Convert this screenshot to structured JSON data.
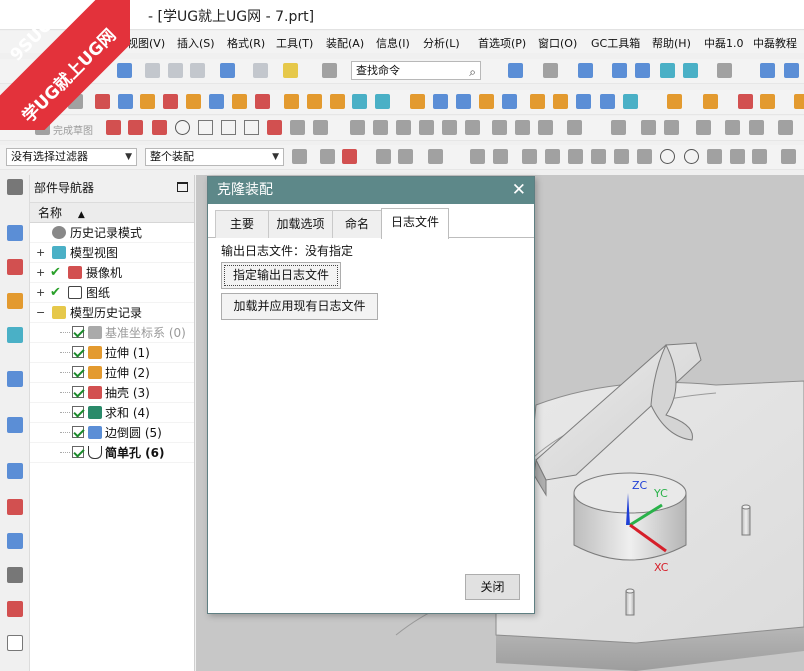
{
  "title_bar": {
    "title": "- [学UG就上UG网 - 7.prt]"
  },
  "watermark": {
    "line1": "9SUG",
    "line2": "学UG就上UG网"
  },
  "menu_bar": {
    "items": [
      "视图(V)",
      "插入(S)",
      "格式(R)",
      "工具(T)",
      "装配(A)",
      "信息(I)",
      "分析(L)",
      "首选项(P)",
      "窗口(O)",
      "GC工具箱",
      "帮助(H)",
      "中磊1.0",
      "中磊教程"
    ]
  },
  "toolbar": {
    "find_command_placeholder": "查找命令",
    "finish_sketch_label": "完成草图",
    "selection_filter": "没有选择过滤器",
    "assembly_scope": "整个装配"
  },
  "navigator": {
    "title": "部件导航器",
    "column_name": "名称",
    "sort_indicator": "▲",
    "items": [
      {
        "label": "历史记录模式",
        "checked": false,
        "disabled": false,
        "bold": false,
        "icon": "clock-icon"
      },
      {
        "label": "模型视图",
        "checked": false,
        "disabled": false,
        "bold": false,
        "icon": "model-views-icon"
      },
      {
        "label": "摄像机",
        "checked": true,
        "disabled": false,
        "bold": false,
        "icon": "camera-icon"
      },
      {
        "label": "图纸",
        "checked": true,
        "disabled": false,
        "bold": false,
        "icon": "drawing-sheet-icon"
      },
      {
        "label": "模型历史记录",
        "checked": false,
        "disabled": false,
        "bold": false,
        "icon": "folder-icon"
      },
      {
        "label": "基准坐标系 (0)",
        "checked": true,
        "disabled": true,
        "bold": false,
        "icon": "datum-csys-icon"
      },
      {
        "label": "拉伸 (1)",
        "checked": true,
        "disabled": false,
        "bold": false,
        "icon": "extrude-icon"
      },
      {
        "label": "拉伸 (2)",
        "checked": true,
        "disabled": false,
        "bold": false,
        "icon": "extrude-icon"
      },
      {
        "label": "抽壳 (3)",
        "checked": true,
        "disabled": false,
        "bold": false,
        "icon": "shell-icon"
      },
      {
        "label": "求和 (4)",
        "checked": true,
        "disabled": false,
        "bold": false,
        "icon": "unite-icon"
      },
      {
        "label": "边倒圆 (5)",
        "checked": true,
        "disabled": false,
        "bold": false,
        "icon": "edge-blend-icon"
      },
      {
        "label": "简单孔 (6)",
        "checked": true,
        "disabled": false,
        "bold": true,
        "icon": "simple-hole-icon"
      }
    ]
  },
  "dialog": {
    "title": "克隆装配",
    "tabs": [
      "主要",
      "加载选项",
      "命名",
      "日志文件"
    ],
    "active_tab": "日志文件",
    "output_log_label": "输出日志文件：没有指定",
    "specify_output_button": "指定输出日志文件",
    "load_apply_button": "加载并应用现有日志文件",
    "close_button": "关闭"
  },
  "viewport": {
    "axis_labels": {
      "z": "ZC",
      "y": "YC",
      "x": "XC"
    },
    "colors": {
      "z": "#1f3fd6",
      "y": "#2ab24a",
      "x": "#d61f2a",
      "background": "#c7c7c7"
    }
  }
}
